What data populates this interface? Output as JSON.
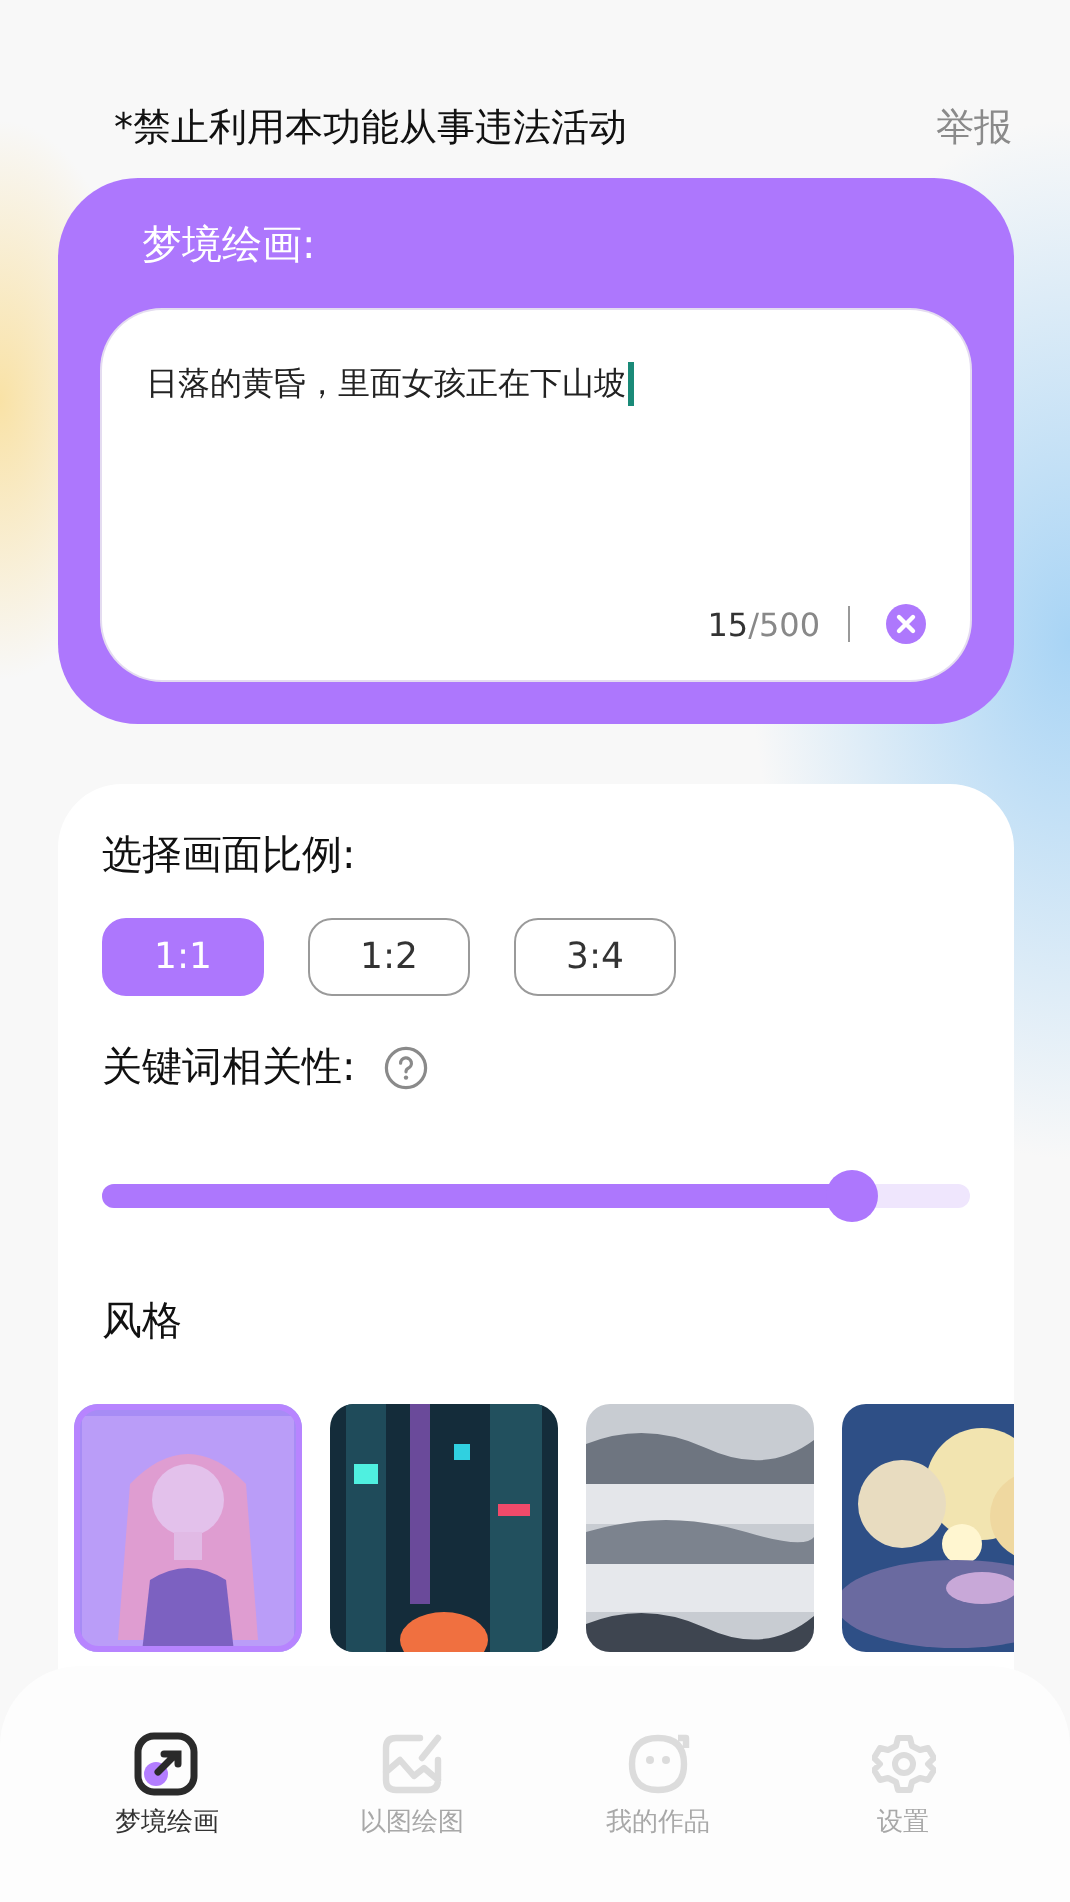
{
  "header": {
    "notice": "*禁止利用本功能从事违法活动",
    "report": "举报"
  },
  "prompt_card": {
    "title": "梦境绘画:",
    "value": "日落的黄昏，里面女孩正在下山坡",
    "focused": true,
    "count": "15",
    "limit": "/500"
  },
  "ratio": {
    "label": "选择画面比例:",
    "options": [
      {
        "label": "1:1",
        "selected": true
      },
      {
        "label": "1:2",
        "selected": false
      },
      {
        "label": "3:4",
        "selected": false
      }
    ]
  },
  "relevance": {
    "label": "关键词相关性:",
    "level": 0.865
  },
  "styles": {
    "label": "风格",
    "items": [
      {
        "kind": "picture",
        "selected": true
      },
      {
        "kind": "picture",
        "selected": false
      },
      {
        "kind": "picture",
        "selected": false
      },
      {
        "kind": "picture",
        "selected": false
      }
    ]
  },
  "nav": [
    {
      "label": "梦境绘画",
      "selected": true
    },
    {
      "label": "以图绘图",
      "selected": false
    },
    {
      "label": "我的作品",
      "selected": false
    },
    {
      "label": "设置",
      "selected": false
    }
  ]
}
